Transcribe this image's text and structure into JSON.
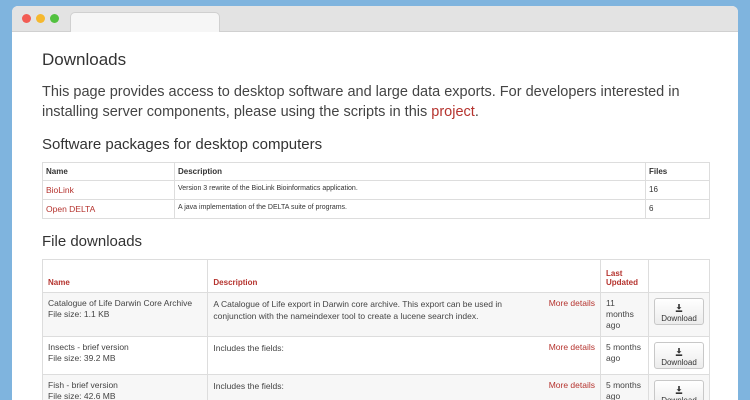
{
  "page": {
    "title": "Downloads",
    "intro_text": "This page provides access to desktop software and large data exports. For developers interested in installing server components, please using the scripts in this ",
    "intro_link": "project",
    "intro_end": "."
  },
  "packages": {
    "heading": "Software packages for desktop computers",
    "columns": [
      "Name",
      "Description",
      "Files"
    ],
    "rows": [
      {
        "name": "BioLink",
        "description": "Version 3 rewrite of the BioLink Bioinformatics application.",
        "files": "16"
      },
      {
        "name": "Open DELTA",
        "description": "A java implementation of the DELTA suite of programs.",
        "files": "6"
      }
    ]
  },
  "file_downloads": {
    "heading": "File downloads",
    "columns": [
      "Name",
      "Description",
      "Last Updated",
      ""
    ],
    "more_label": "More details",
    "download_label": "Download",
    "rows": [
      {
        "name": "Catalogue of Life Darwin Core Archive",
        "size": "File size: 1.1 KB",
        "description": "A Catalogue of Life export in Darwin core archive. This export can be used in conjunction with the nameindexer tool to create a lucene search index.",
        "updated": "11 months ago"
      },
      {
        "name": "Insects - brief version",
        "size": "File size: 39.2 MB",
        "description": "Includes the fields:",
        "updated": "5 months ago"
      },
      {
        "name": "Fish - brief version",
        "size": "File size: 42.6 MB",
        "description": "Includes the fields:",
        "updated": "5 months ago"
      }
    ]
  },
  "colors": {
    "accent": "#b5332e",
    "background": "#7fb4de"
  }
}
